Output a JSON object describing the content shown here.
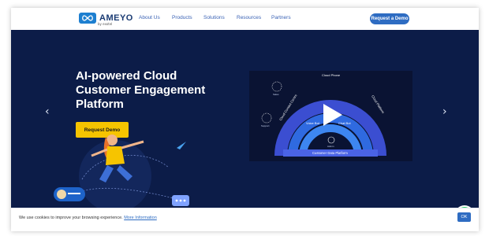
{
  "brand": {
    "name": "AMEYO",
    "tagline": "by exotel"
  },
  "nav": {
    "links": [
      "About Us",
      "Products",
      "Solutions",
      "Resources",
      "Partners"
    ],
    "cta_label": "Request a Demo"
  },
  "hero": {
    "headline_lines": [
      "AI-powered Cloud",
      "Customer Engagement",
      "Platform"
    ],
    "button_label": "Request Demo",
    "prev_arrow": "‹",
    "next_arrow": "›"
  },
  "video": {
    "arc_labels": [
      "Cloud Phone",
      "Cloud Contact Centre",
      "Cloud Platform"
    ],
    "inner_labels": [
      "Voice Bot",
      "Chat Bot"
    ],
    "base_label": "Customer Data Platform",
    "icon_labels": [
      "Sales",
      "Support",
      "Admin"
    ]
  },
  "cookie": {
    "message": "We use cookies to improve your browsing experience.",
    "link_label": "More Information",
    "ok_label": "OK"
  },
  "colors": {
    "hero_bg": "#0c1c48",
    "accent_blue": "#2e6cc2",
    "accent_yellow": "#f6c400",
    "whatsapp_green": "#25d366"
  }
}
